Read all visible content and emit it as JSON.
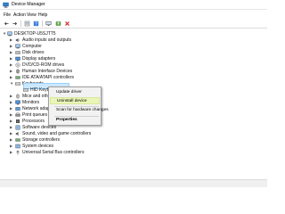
{
  "window": {
    "title": "Device Manager",
    "app_icon": "device-manager-icon"
  },
  "menu": [
    "File",
    "Action",
    "View",
    "Help"
  ],
  "toolbar": [
    "back-icon",
    "forward-icon",
    "properties-icon",
    "help-icon",
    "scan-icon",
    "update-driver-icon",
    "uninstall-icon"
  ],
  "tree": {
    "root": "DESKTOP-U5SJTT5",
    "categories": [
      "Audio inputs and outputs",
      "Computer",
      "Disk drives",
      "Display adapters",
      "DVD/CD-ROM drives",
      "Human Interface Devices",
      "IDE ATA/ATAPI controllers",
      "Keyboards",
      "HID Keyboard Device",
      "Mice and other pointing devices",
      "Monitors",
      "Network adapters",
      "Print queues",
      "Processors",
      "Software devices",
      "Sound, video and game controllers",
      "Storage controllers",
      "System devices",
      "Universal Serial Bus controllers"
    ]
  },
  "context_menu": {
    "items": [
      "Update driver",
      "Uninstall device",
      "Scan for hardware changes",
      "Properties"
    ],
    "highlighted": "Uninstall device"
  },
  "colors": {
    "selection": "#cce8ff",
    "menu_highlight": "#e9f6b8",
    "accent": "#1e74c8"
  }
}
